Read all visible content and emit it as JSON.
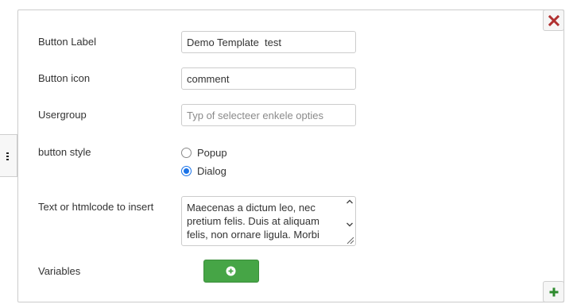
{
  "form": {
    "button_label": {
      "label": "Button Label",
      "value": "Demo Template  test"
    },
    "button_icon": {
      "label": "Button icon",
      "value": "comment"
    },
    "usergroup": {
      "label": "Usergroup",
      "placeholder": "Typ of selecteer enkele opties"
    },
    "button_style": {
      "label": "button style",
      "options": [
        {
          "label": "Popup",
          "checked": false
        },
        {
          "label": "Dialog",
          "checked": true
        }
      ]
    },
    "text_insert": {
      "label": "Text or htmlcode to insert",
      "value": "Maecenas a dictum leo, nec pretium felis. Duis at aliquam felis, non ornare ligula. Morbi"
    },
    "variables": {
      "label": "Variables"
    }
  },
  "icons": {
    "close": "close-icon",
    "add": "plus-icon",
    "add_variable": "plus-circle-icon",
    "side_handle": "vertical-dots-icon"
  },
  "colors": {
    "close_icon": "#b03030",
    "add_icon": "#2e8b2e",
    "green_button": "#46a546",
    "radio_checked": "#1a73e8"
  }
}
